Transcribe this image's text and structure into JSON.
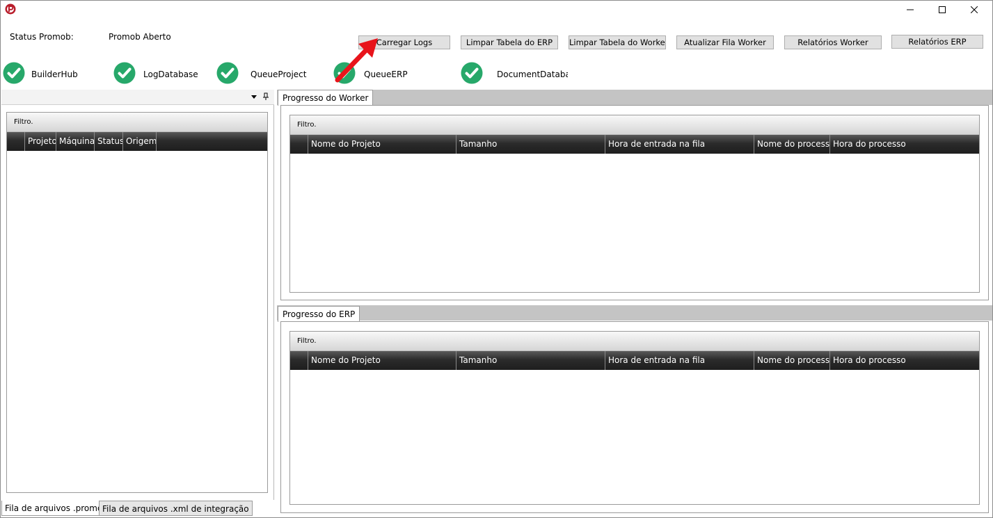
{
  "window": {
    "app_icon": "app-logo-icon",
    "controls": {
      "minimize": "minimize-icon",
      "maximize": "maximize-icon",
      "close": "close-icon"
    }
  },
  "status": {
    "label": "Status Promob:",
    "value": "Promob Aberto"
  },
  "toolbar": {
    "carregar_logs": "Carregar Logs",
    "limpar_erp": "Limpar Tabela do ERP",
    "limpar_worker": "Limpar Tabela do Worker",
    "atualizar_fila": "Atualizar Fila Worker",
    "relatorios_worker": "Relatórios Worker",
    "relatorios_erp": "Relatórios ERP"
  },
  "services": [
    {
      "name": "BuilderHub",
      "status": "ok",
      "icon": "check-circle-icon"
    },
    {
      "name": "LogDatabase",
      "status": "ok",
      "icon": "check-circle-icon"
    },
    {
      "name": "QueueProject",
      "status": "ok",
      "icon": "check-circle-icon"
    },
    {
      "name": "QueueERP",
      "status": "ok",
      "icon": "check-circle-icon"
    },
    {
      "name": "DocumentDatabase",
      "status": "ok",
      "icon": "check-circle-icon"
    }
  ],
  "left_panel": {
    "filter_label": "Filtro.",
    "columns": [
      "Projeto",
      "Máquina",
      "Status",
      "Origem"
    ]
  },
  "worker_panel": {
    "tab": "Progresso do Worker",
    "filter_label": "Filtro.",
    "columns": [
      "Nome do Projeto",
      "Tamanho",
      "Hora de entrada na fila",
      "Nome do processo",
      "Hora do processo"
    ]
  },
  "erp_panel": {
    "tab": "Progresso do ERP",
    "filter_label": "Filtro.",
    "columns": [
      "Nome do Projeto",
      "Tamanho",
      "Hora de entrada na fila",
      "Nome do processo",
      "Hora do processo"
    ]
  },
  "bottom_tabs": [
    "Fila de arquivos .promob",
    "Fila de arquivos .xml de integração"
  ],
  "colors": {
    "check_green": "#27a86a",
    "annotation_arrow": "#e8141b",
    "grid_header": "#262626"
  }
}
